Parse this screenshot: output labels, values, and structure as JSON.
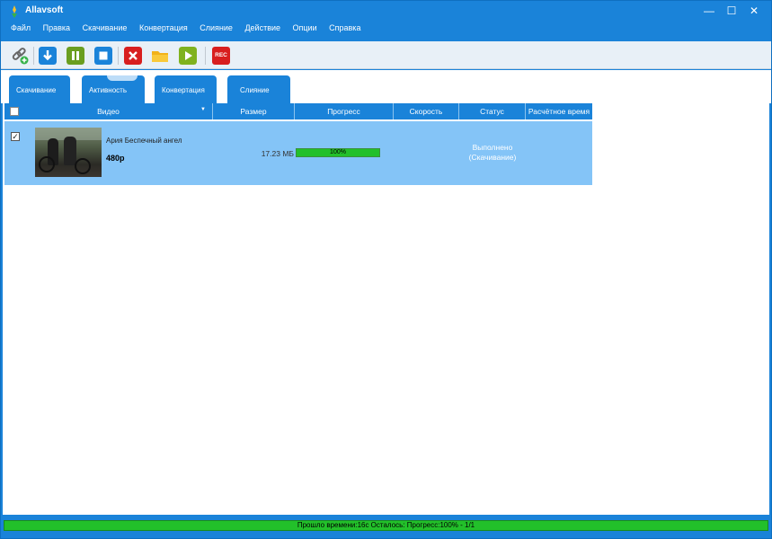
{
  "app": {
    "title": "Allavsoft"
  },
  "window_controls": {
    "minimize": "—",
    "maximize": "☐",
    "close": "✕"
  },
  "menu": [
    "Файл",
    "Правка",
    "Скачивание",
    "Конвертация",
    "Слияние",
    "Действие",
    "Опции",
    "Справка"
  ],
  "toolbar": {
    "buttons": [
      {
        "icon": "add-link-icon"
      },
      {
        "icon": "download-icon",
        "color": "#1a83d9"
      },
      {
        "icon": "pause-icon",
        "color": "#6a9e1f"
      },
      {
        "icon": "stop-icon",
        "color": "#1a83d9"
      },
      {
        "icon": "delete-icon",
        "color": "#d81e1e"
      },
      {
        "icon": "folder-icon",
        "color": "#f2b21a"
      },
      {
        "icon": "play-icon",
        "color": "#7fb21e"
      },
      {
        "icon": "record-icon",
        "color": "#d81e1e",
        "label": "REC"
      }
    ]
  },
  "tabs": [
    {
      "label": "Скачивание"
    },
    {
      "label": "Активность",
      "active": true
    },
    {
      "label": "Конвертация"
    },
    {
      "label": "Слияние"
    }
  ],
  "table": {
    "headers": {
      "video": "Видео",
      "size": "Размер",
      "progress": "Прогресс",
      "speed": "Скорость",
      "status": "Статус",
      "eta": "Расчётное время"
    },
    "rows": [
      {
        "checked": true,
        "title": "Ария Беспечный ангел",
        "quality": "480p",
        "size": "17.23 MБ",
        "progress_value": 1.0,
        "progress_label": "100%",
        "status_line1": "Выполнено",
        "status_line2": "(Скачивание)"
      }
    ]
  },
  "statusbar": {
    "text": "Прошло времени:16с Осталось: Прогресс:100% - 1/1"
  },
  "colors": {
    "accent": "#1a83d9",
    "row_selected": "#84c4f7",
    "progress_green": "#22c02a"
  }
}
